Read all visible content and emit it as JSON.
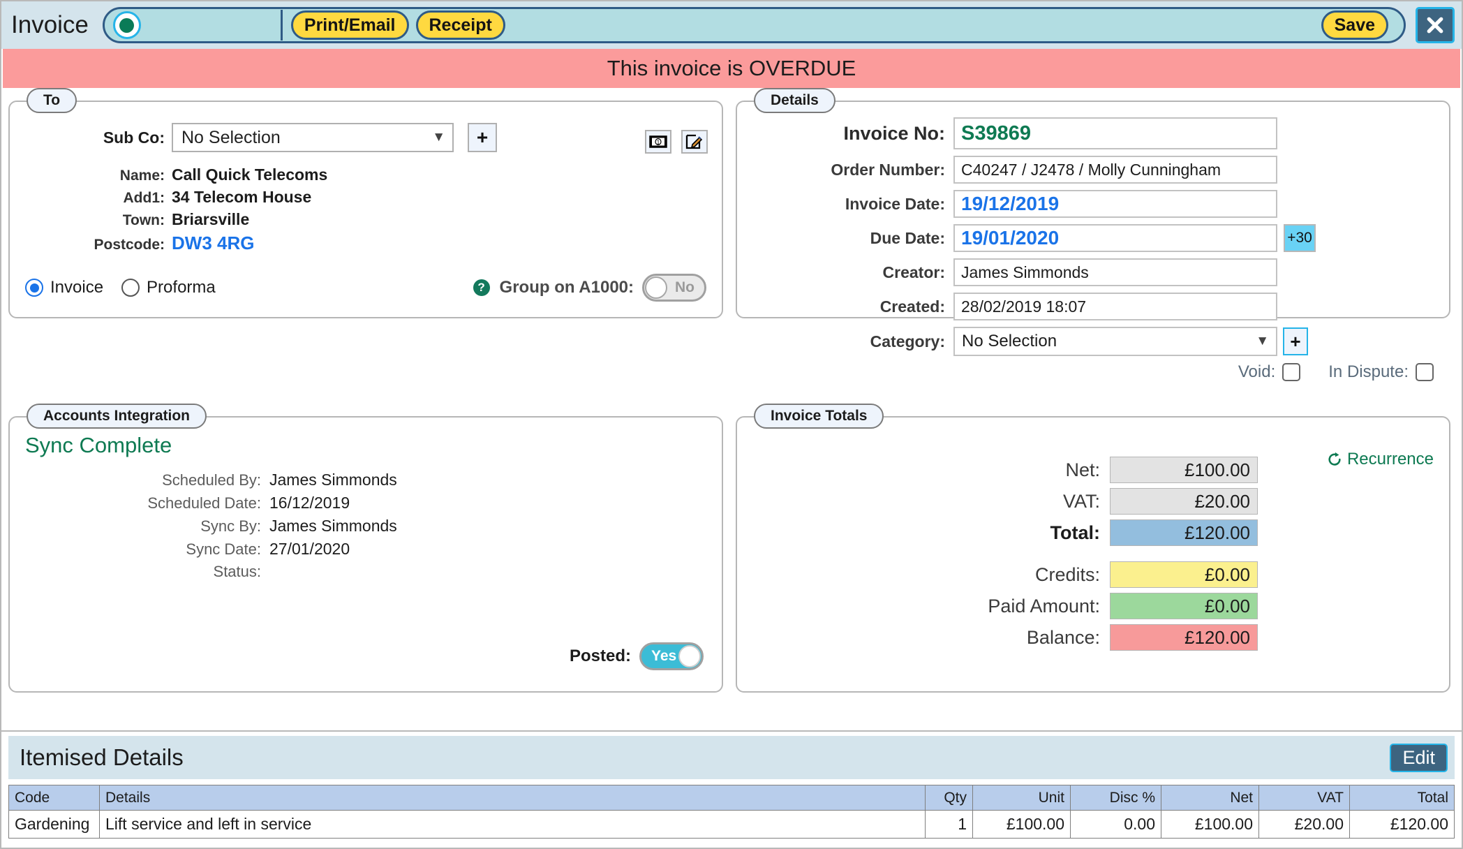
{
  "window": {
    "title": "Invoice",
    "close_icon": "close-x-icon"
  },
  "toolbar": {
    "status_indicator": "green-status-dot",
    "buttons": [
      {
        "label": "Print/Email",
        "name": "print-email-button"
      },
      {
        "label": "Receipt",
        "name": "receipt-button"
      },
      {
        "label": "Save",
        "name": "save-button"
      }
    ]
  },
  "banner": {
    "text": "This invoice is OVERDUE",
    "color": "#fb9b9b"
  },
  "to_panel": {
    "legend": "To",
    "subco_label": "Sub Co:",
    "subco_value": "No Selection",
    "add_button": "+",
    "icons": [
      {
        "name": "money-icon"
      },
      {
        "name": "edit-pencil-icon"
      }
    ],
    "address": [
      {
        "label": "Name:",
        "value": "Call Quick Telecoms",
        "link": false
      },
      {
        "label": "Add1:",
        "value": "34 Telecom House",
        "link": false
      },
      {
        "label": "Town:",
        "value": "Briarsville",
        "link": false
      },
      {
        "label": "Postcode:",
        "value": "DW3 4RG",
        "link": true
      }
    ],
    "radios": [
      {
        "label": "Invoice",
        "selected": true
      },
      {
        "label": "Proforma",
        "selected": false
      }
    ],
    "group_help_icon": "help-question-icon",
    "group_label": "Group on A1000:",
    "group_value": "No",
    "group_on": false
  },
  "details_panel": {
    "legend": "Details",
    "fields": [
      {
        "label": "Invoice No:",
        "value": "S39869",
        "style": "green"
      },
      {
        "label": "Order Number:",
        "value": "C40247 / J2478 / Molly Cunningham",
        "style": "plain"
      },
      {
        "label": "Invoice Date:",
        "value": "19/12/2019",
        "style": "blue"
      },
      {
        "label": "Due Date:",
        "value": "19/01/2020",
        "style": "blue",
        "badge": "+30"
      },
      {
        "label": "Creator:",
        "value": "James Simmonds",
        "style": "plain"
      },
      {
        "label": "Created:",
        "value": "28/02/2019  18:07",
        "style": "plain"
      }
    ],
    "category_label": "Category:",
    "category_value": "No Selection",
    "category_add": "+",
    "void_label": "Void:",
    "void_checked": false,
    "dispute_label": "In Dispute:",
    "dispute_checked": false
  },
  "accounts_panel": {
    "legend": "Accounts Integration",
    "status_title": "Sync Complete",
    "rows": [
      {
        "label": "Scheduled By:",
        "value": "James Simmonds"
      },
      {
        "label": "Scheduled Date:",
        "value": "16/12/2019"
      },
      {
        "label": "Sync By:",
        "value": "James Simmonds"
      },
      {
        "label": "Sync Date:",
        "value": "27/01/2020"
      },
      {
        "label": "Status:",
        "value": ""
      }
    ],
    "posted_label": "Posted:",
    "posted_value": "Yes",
    "posted_on": true
  },
  "totals_panel": {
    "legend": "Invoice Totals",
    "recurrence_label": "Recurrence",
    "recurrence_icon": "refresh-recurrence-icon",
    "rows": [
      {
        "label": "Net:",
        "value": "£100.00",
        "bg": "#e3e3e3",
        "bold": false
      },
      {
        "label": "VAT:",
        "value": "£20.00",
        "bg": "#e3e3e3",
        "bold": false
      },
      {
        "label": "Total:",
        "value": "£120.00",
        "bg": "#93bede",
        "bold": true
      },
      {
        "label": "Credits:",
        "value": "£0.00",
        "bg": "#fbf08e",
        "bold": false,
        "gap": true
      },
      {
        "label": "Paid Amount:",
        "value": "£0.00",
        "bg": "#9cd89c",
        "bold": false
      },
      {
        "label": "Balance:",
        "value": "£120.00",
        "bg": "#f79a9a",
        "bold": false
      }
    ]
  },
  "items_panel": {
    "title": "Itemised Details",
    "edit_label": "Edit",
    "columns": [
      "Code",
      "Details",
      "Qty",
      "Unit",
      "Disc %",
      "Net",
      "VAT",
      "Total"
    ],
    "rows": [
      {
        "code": "Gardening",
        "details": "Lift service and left in service",
        "qty": "1",
        "unit": "£100.00",
        "disc": "0.00",
        "net": "£100.00",
        "vat": "£20.00",
        "total": "£120.00"
      }
    ]
  }
}
